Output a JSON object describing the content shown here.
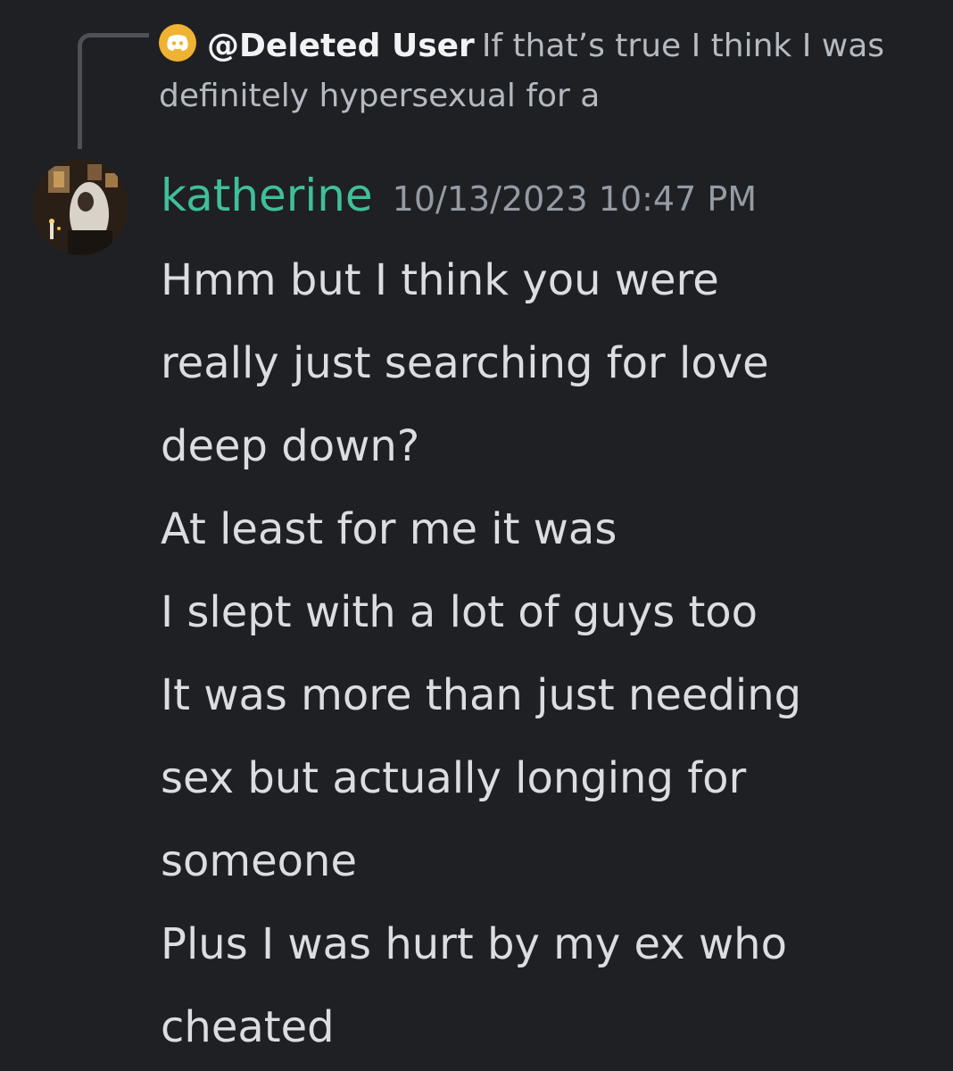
{
  "reply": {
    "author": "@Deleted User",
    "text": "If that’s true I think I was definitely hypersexual for a",
    "avatar_icon": "discord-logo-icon",
    "avatar_color": "#f0b232"
  },
  "message": {
    "author": "katherine",
    "author_color": "#3fbf9b",
    "timestamp": "10/13/2023 10:47 PM",
    "lines": [
      "Hmm but I think you were",
      "really just searching for love",
      "deep down?",
      "At least for me it was",
      "I slept with a lot of guys too",
      "It was more than just needing",
      "sex but actually longing for",
      "someone",
      "Plus I was hurt by my ex who",
      "cheated"
    ]
  }
}
